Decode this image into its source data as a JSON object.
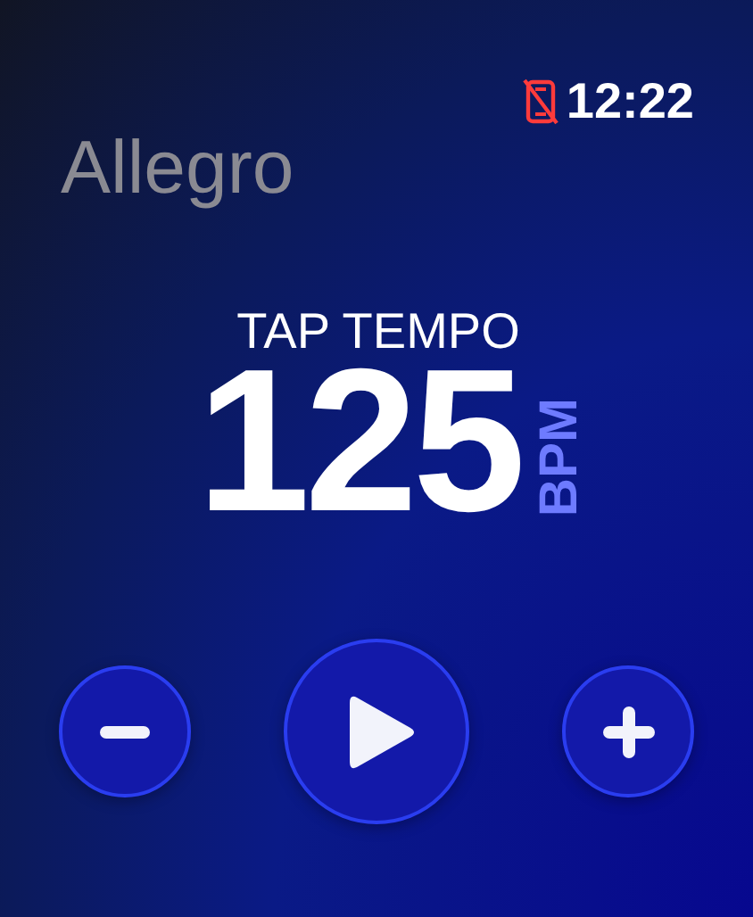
{
  "status_bar": {
    "phone_connected": false,
    "time": "12:22"
  },
  "title": "Allegro",
  "tempo": {
    "label": "TAP TEMPO",
    "value": "125",
    "unit": "BPM"
  },
  "buttons": [
    {
      "kind": "minus"
    },
    {
      "kind": "play"
    },
    {
      "kind": "plus"
    }
  ]
}
